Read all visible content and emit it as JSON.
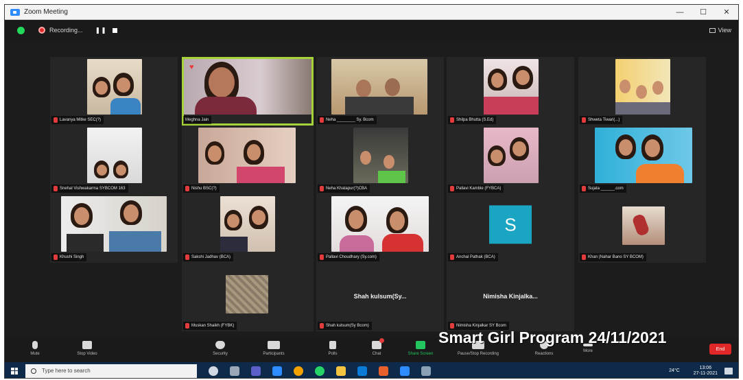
{
  "window": {
    "title": "Zoom Meeting",
    "min": "—",
    "max": "☐",
    "close": "✕"
  },
  "meeting": {
    "recording_label": "Recording...",
    "pause_glyph": "❚❚",
    "view_label": "View"
  },
  "participants": [
    {
      "name": "Lavanya Mitke SEC(?)"
    },
    {
      "name": "Meghna Jain"
    },
    {
      "name": "Neha ________ Sy. Bcom"
    },
    {
      "name": "Shilpa Bhutta (S.Ed)"
    },
    {
      "name": "Shweta Tiwari(...)"
    },
    {
      "name": "Snehal Vishwakarma SYBCOM 163"
    },
    {
      "name": "Nishu BSC(?)"
    },
    {
      "name": "Neha Khatapur(?)CBA"
    },
    {
      "name": "Pallavi Kamble (FYBCA)"
    },
    {
      "name": "Sujata ______.com"
    },
    {
      "name": "Khushi Singh"
    },
    {
      "name": "Sakshi Jadhav (BCA)"
    },
    {
      "name": "Pallavi Choudhary (Sy.com)"
    },
    {
      "name": "Anchal Pathak (BCA)"
    },
    {
      "name": "Khan (Nahar Bano SY BCOM)"
    },
    {
      "name": "Muskan Shaikh (FYBK)"
    },
    {
      "name": "Shah kulsum(Sy Bcom)",
      "center": "Shah kulsum(Sy..."
    },
    {
      "name": "Nimisha Kinjalkar SY Bcom",
      "center": "Nimisha Kinjalka..."
    }
  ],
  "avatar_letter": "S",
  "toolbar": {
    "items": [
      {
        "label": "Mute",
        "icon": "microphone-icon"
      },
      {
        "label": "Stop Video",
        "icon": "video-camera-icon"
      },
      {
        "label": "Security",
        "icon": "shield-icon"
      },
      {
        "label": "Participants",
        "icon": "participants-icon",
        "count": "18"
      },
      {
        "label": "Polls",
        "icon": "polls-icon"
      },
      {
        "label": "Chat",
        "icon": "chat-icon"
      },
      {
        "label": "Share Screen",
        "icon": "share-screen-icon"
      },
      {
        "label": "Pause/Stop Recording",
        "icon": "recording-icon"
      },
      {
        "label": "Reactions",
        "icon": "reactions-icon"
      },
      {
        "label": "More",
        "icon": "more-icon"
      }
    ],
    "end_label": "End"
  },
  "caption": "Smart Girl Program 24/11/2021",
  "taskbar": {
    "search_placeholder": "Type here to search",
    "weather": "24°C",
    "time": "13:06",
    "date": "27-11-2021"
  },
  "colors": {
    "active_speaker": "#a6d23a",
    "share_screen": "#23c55e",
    "end_button": "#e02828",
    "avatar_bg": "#1aa6c2"
  }
}
